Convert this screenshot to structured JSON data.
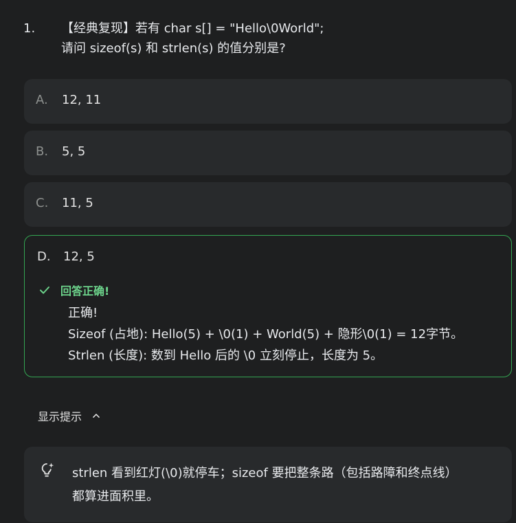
{
  "question": {
    "number": "1.",
    "lines": [
      "【经典复现】若有 char s[] = \"Hello\\0World\";",
      "请问 sizeof(s) 和 strlen(s) 的值分别是?"
    ]
  },
  "options": [
    {
      "letter": "A.",
      "value": "12, 11"
    },
    {
      "letter": "B.",
      "value": "5, 5"
    },
    {
      "letter": "C.",
      "value": "11, 5"
    },
    {
      "letter": "D.",
      "value": "12, 5"
    }
  ],
  "feedback": {
    "status": "回答正确!",
    "lines": [
      "正确!",
      "Sizeof (占地): Hello(5) + \\0(1) + World(5) + 隐形\\0(1) = 12字节。",
      "Strlen (长度): 数到 Hello 后的 \\0 立刻停止，长度为 5。"
    ]
  },
  "hint": {
    "toggle_label": "显示提示",
    "lines": [
      "strlen 看到红灯(\\0)就停车；sizeof 要把整条路（包括路障和终点线）",
      "都算进面积里。"
    ]
  },
  "colors": {
    "background": "#1e1f20",
    "card": "#282a2c",
    "correct_border": "#34a853",
    "correct_text": "#6dd58c"
  },
  "icons": {
    "check": "check-icon",
    "chevron": "chevron-up-icon",
    "hint": "lightbulb-sparkle-icon"
  }
}
